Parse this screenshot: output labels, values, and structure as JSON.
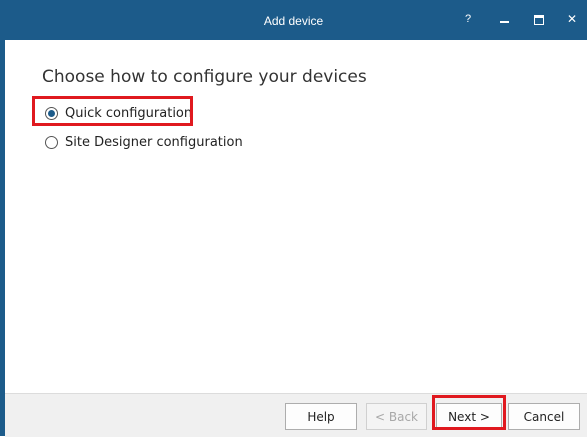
{
  "window": {
    "title": "Add device",
    "help_glyph": "?",
    "close_glyph": "✕",
    "accent_color": "#1c5b8a"
  },
  "content": {
    "heading": "Choose how to configure your devices",
    "options": [
      {
        "label": "Quick configuration",
        "selected": true
      },
      {
        "label": "Site Designer configuration",
        "selected": false
      }
    ]
  },
  "footer": {
    "help_label": "Help",
    "back_label": "< Back",
    "next_label": "Next >",
    "cancel_label": "Cancel"
  },
  "annotations": {
    "highlight_color": "#e0191f"
  }
}
